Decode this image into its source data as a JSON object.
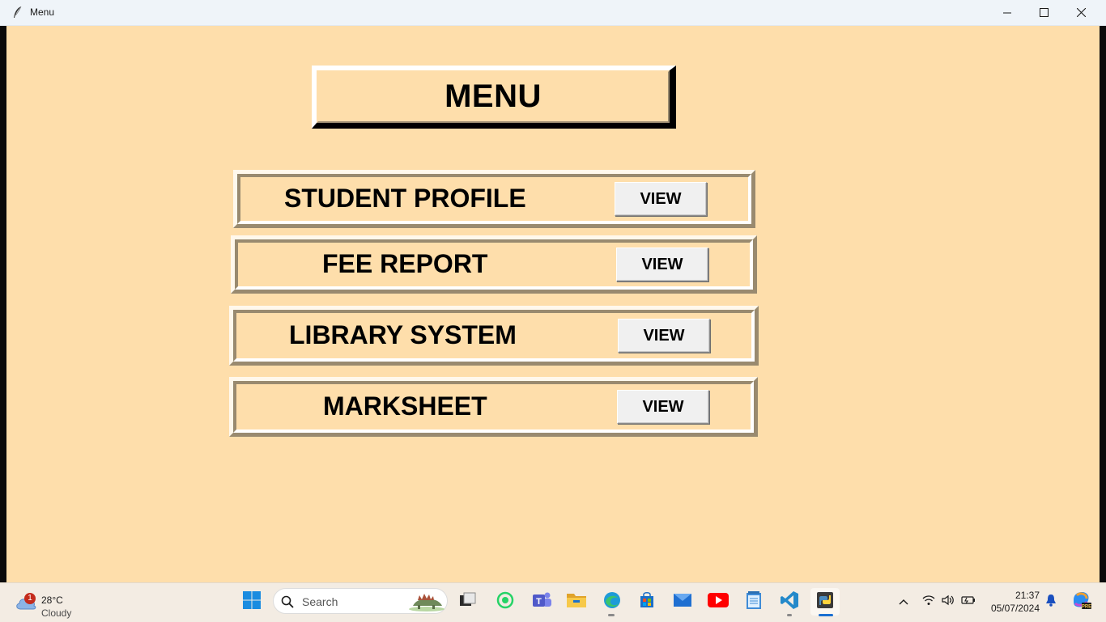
{
  "window": {
    "title": "Menu"
  },
  "menu": {
    "heading": "MENU",
    "items": [
      {
        "label": "STUDENT PROFILE",
        "button": "VIEW"
      },
      {
        "label": "FEE REPORT",
        "button": "VIEW"
      },
      {
        "label": "LIBRARY SYSTEM",
        "button": "VIEW"
      },
      {
        "label": "MARKSHEET",
        "button": "VIEW"
      }
    ]
  },
  "taskbar": {
    "weather": {
      "temp": "28°C",
      "condition": "Cloudy",
      "badge": "1"
    },
    "search_placeholder": "Search",
    "clock": {
      "time": "21:37",
      "date": "05/07/2024"
    },
    "apps": [
      "start-icon",
      "search-icon",
      "task-view-icon",
      "whatsapp-icon",
      "teams-icon",
      "file-explorer-icon",
      "edge-icon",
      "store-icon",
      "mail-icon",
      "youtube-icon",
      "notepad-icon",
      "vscode-icon",
      "python-icon"
    ]
  },
  "colors": {
    "background": "#fedeab",
    "frame_shadow": "#998a6f",
    "button": "#f0f0f0"
  }
}
